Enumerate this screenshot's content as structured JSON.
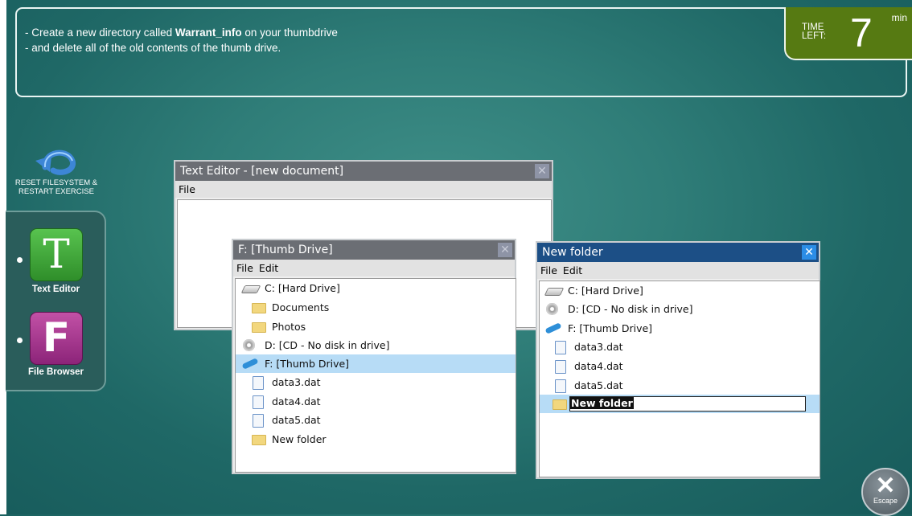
{
  "task": {
    "line1_prefix": "- Create a new directory called ",
    "line1_bold": "Warrant_info",
    "line1_suffix": " on your thumbdrive",
    "line2": "- and delete all of the old contents of the thumb drive."
  },
  "timer": {
    "label": "TIME\nLEFT:",
    "value": "7",
    "unit": "min"
  },
  "reset": {
    "label": "RESET FILESYSTEM & RESTART EXERCISE"
  },
  "dock": {
    "apps": [
      {
        "letter": "T",
        "label": "Text Editor"
      },
      {
        "letter": "F",
        "label": "File Browser"
      }
    ]
  },
  "text_editor": {
    "title": "Text Editor - [new document]",
    "menu": [
      "File"
    ]
  },
  "browser_f": {
    "title": "F: [Thumb Drive]",
    "menu": [
      "File",
      "Edit"
    ],
    "items": [
      {
        "icon": "hard-drive-icon",
        "label": "C: [Hard Drive]"
      },
      {
        "icon": "folder-icon",
        "label": "Documents"
      },
      {
        "icon": "folder-icon",
        "label": "Photos"
      },
      {
        "icon": "cd-icon",
        "label": "D: [CD - No disk in drive]"
      },
      {
        "icon": "thumb-drive-icon",
        "label": "F: [Thumb Drive]",
        "selected": true
      },
      {
        "icon": "file-icon",
        "label": "data3.dat"
      },
      {
        "icon": "file-icon",
        "label": "data4.dat"
      },
      {
        "icon": "file-icon",
        "label": "data5.dat"
      },
      {
        "icon": "folder-icon",
        "label": "New folder"
      }
    ]
  },
  "browser_new": {
    "title": "New folder",
    "menu": [
      "File",
      "Edit"
    ],
    "items": [
      {
        "icon": "hard-drive-icon",
        "label": "C: [Hard Drive]"
      },
      {
        "icon": "cd-icon",
        "label": "D: [CD - No disk in drive]"
      },
      {
        "icon": "thumb-drive-icon",
        "label": "F: [Thumb Drive]"
      },
      {
        "icon": "file-icon",
        "label": "data3.dat"
      },
      {
        "icon": "file-icon",
        "label": "data4.dat"
      },
      {
        "icon": "file-icon",
        "label": "data5.dat"
      }
    ],
    "rename_value": "New folder"
  },
  "escape": {
    "label": "Escape"
  },
  "colors": {
    "accent_title_active": "#1c4f86",
    "selection": "#b7dcf6",
    "timer_bg": "#567a12"
  }
}
